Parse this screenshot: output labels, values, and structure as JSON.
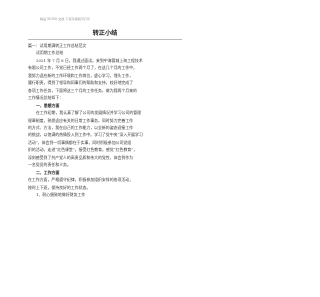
{
  "header": {
    "note": "精品 WORD 文档  下载可编辑可打印"
  },
  "title": "转正小结",
  "body": [
    "篇一：试用期满转正工作总结范文",
    "试用期工作总结",
    "2021 年 7 月 8 日，我通过面试，来到中海蓉城上海工程技术",
    "有限公司工作，不觉已经工作两个月了，在这几个月的工作中，",
    "我努力适应新的工作环境和工作岗位，虚心学习，埋头工作，",
    "履行职责，得到了领导和同事们的帮助和支持，较好地完成了",
    "各项工作任务，下面将这三个月的工作任务，做为我两个月来的",
    "工作情况总结如下：",
    "一、思想方面",
    "在工作初期，我认真了解了公司的发展情况并学习公司的管理",
    "规章制度，熟悉适应有关的日常工作事务，同时努力完善工作",
    "的方式、方法，我在自己的工作能力，以全新的姿态迎接工作",
    "的挑战，以饱满的热情投入到工作中。学习了党中央“深入开展学习",
    "活动”，体会到一切事情都在于实事，同时积极参加公司党组",
    "织的活动，走进“红色课堂”，接受红色教育，感觉“红色教育”，",
    "深刻感受到了共产党人的高贵品质和伟大的党性，体会到作为",
    "一名党员的责任和义务。",
    "二、工作方面",
    "在工作方面，严格遵守纪律，积极参加组织安排的各项活动，",
    "按时上下班，保持良好的工作状态。",
    "1、耐心细致地做好财务工作"
  ]
}
